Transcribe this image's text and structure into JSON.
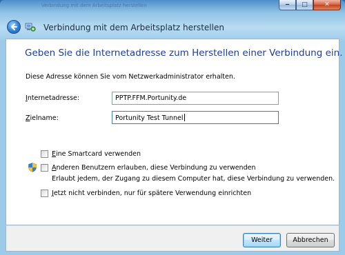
{
  "window": {
    "title": "Verbindung mit dem Arbeitsplatz herstellen",
    "caption_buttons": {
      "minimize": "‒",
      "maximize": "□",
      "close": "✕"
    }
  },
  "header": {
    "back_icon": "back-arrow-icon",
    "wizard_icon": "network-connection-icon",
    "title": "Verbindung mit dem Arbeitsplatz herstellen"
  },
  "main": {
    "heading": "Geben Sie die Internetadresse zum Herstellen einer Verbindung ein.",
    "subtext": "Diese Adresse können Sie vom Netzwerkadministrator erhalten.",
    "fields": {
      "internet_address": {
        "label_access": "I",
        "label_rest": "nternetadresse:",
        "value": "PPTP.FFM.Portunity.de"
      },
      "destination_name": {
        "label_access": "Z",
        "label_rest": "ielname:",
        "value": "Portunity Test Tunnel"
      }
    },
    "options": {
      "smartcard": {
        "label_access": "E",
        "label_rest": "ine Smartcard verwenden",
        "checked": false
      },
      "allow_others": {
        "label_access": "A",
        "label_rest": "nderen Benutzern erlauben, diese Verbindung zu verwenden",
        "description": "Erlaubt jedem, der Zugang zu diesem Computer hat, diese Verbindung zu verwenden.",
        "checked": false,
        "icon": "security-shield-icon"
      },
      "connect_later": {
        "label_access": "J",
        "label_rest": "etzt nicht verbinden, nur für spätere Verwendung einrichten",
        "checked": false
      }
    }
  },
  "footer": {
    "next_label": "Weiter",
    "cancel_label": "Abbrechen"
  },
  "colors": {
    "heading": "#1e3d99",
    "window_glass": "#8fc3e6",
    "default_button_border": "#3c7fb1"
  }
}
